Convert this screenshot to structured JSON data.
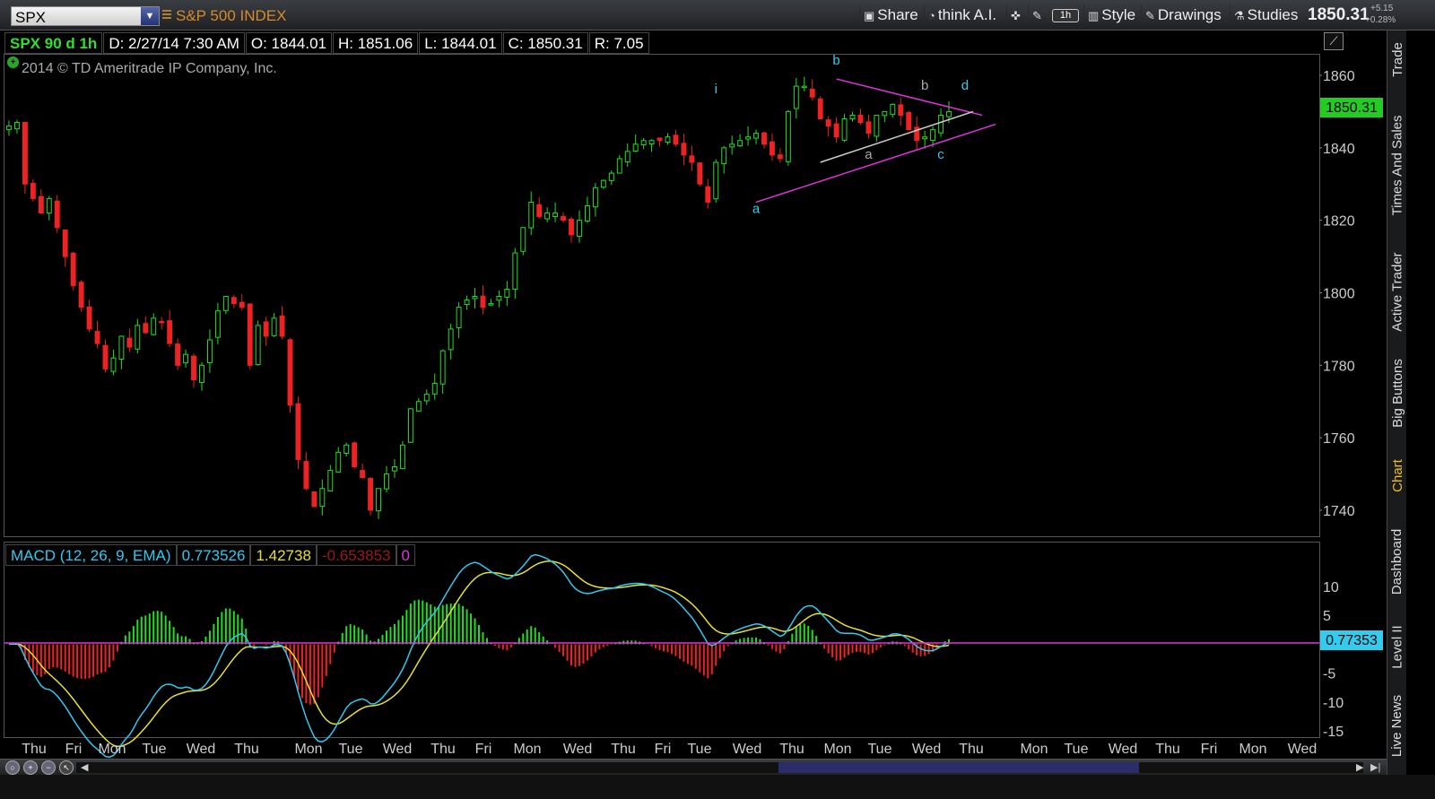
{
  "toolbar": {
    "symbol": "SPX",
    "symbol_name": "S&P 500 INDEX",
    "share": "Share",
    "think_ai": "think A.I.",
    "timeframe": "1h",
    "style": "Style",
    "drawings": "Drawings",
    "studies": "Studies",
    "last_price": "1850.31",
    "change_abs": "+5.15",
    "change_pct": "+0.28%"
  },
  "info": {
    "symbol_period": "SPX 90 d 1h",
    "date": "D: 2/27/14 7:30 AM",
    "open": "O: 1844.01",
    "high": "H: 1851.06",
    "low": "L: 1844.01",
    "close": "C: 1850.31",
    "range": "R: 7.05",
    "copyright": "2014 © TD Ameritrade IP Company, Inc."
  },
  "macd": {
    "label": "MACD (12, 26, 9, EMA)",
    "value": "0.773526",
    "avg": "1.42738",
    "diff": "-0.653853",
    "zero": "0",
    "last_badge": "0.77353"
  },
  "sidebar": {
    "items": [
      "Trade",
      "Times And Sales",
      "Active Trader",
      "Big Buttons",
      "Chart",
      "Dashboard",
      "Level II",
      "Live News"
    ]
  },
  "colors": {
    "up": "#22dd22",
    "down": "#ee2222",
    "macd": "#33c8f0",
    "signal": "#e8e030",
    "trendline": "#dd33dd",
    "triangle_base": "#cccccc",
    "price_badge": "#22cc22",
    "macd_badge": "#33ccee"
  },
  "chart_data": [
    {
      "type": "candlestick",
      "title": "SPX 90 d 1h",
      "y_ticks": [
        1860,
        1840,
        1820,
        1800,
        1780,
        1760,
        1740
      ],
      "ylim": [
        1733,
        1866
      ],
      "x_day_labels": [
        "Thu",
        "Fri",
        "Mon",
        "Tue",
        "Wed",
        "Thu",
        "Mon",
        "Tue",
        "Wed",
        "Thu",
        "Fri",
        "Mon",
        "Wed",
        "Thu",
        "Fri",
        "Tue",
        "Wed",
        "Thu",
        "Mon",
        "Tue",
        "Wed",
        "Thu",
        "Mon",
        "Tue",
        "Wed",
        "Thu",
        "Fri",
        "Mon",
        "Wed"
      ],
      "close_path": [
        1846,
        1847,
        1830,
        1826,
        1822,
        1826,
        1818,
        1810,
        1802,
        1796,
        1790,
        1786,
        1779,
        1782,
        1788,
        1785,
        1791,
        1789,
        1793,
        1792,
        1786,
        1780,
        1783,
        1776,
        1780,
        1787,
        1795,
        1799,
        1797,
        1796,
        1780,
        1791,
        1788,
        1793,
        1788,
        1769,
        1754,
        1746,
        1741,
        1746,
        1751,
        1756,
        1758,
        1752,
        1749,
        1740,
        1746,
        1750,
        1752,
        1758,
        1768,
        1770,
        1772,
        1775,
        1784,
        1790,
        1796,
        1798,
        1799,
        1796,
        1797,
        1799,
        1801,
        1811,
        1818,
        1825,
        1821,
        1822,
        1822,
        1820,
        1816,
        1820,
        1824,
        1829,
        1831,
        1833,
        1837,
        1839,
        1841,
        1842,
        1842,
        1842,
        1843,
        1841,
        1838,
        1836,
        1830,
        1825,
        1836,
        1840,
        1841,
        1842,
        1843,
        1844,
        1841,
        1838,
        1837,
        1850,
        1857,
        1857,
        1854,
        1848,
        1846,
        1843,
        1848,
        1849,
        1847,
        1844,
        1849,
        1850,
        1852,
        1849,
        1845,
        1842,
        1843,
        1845,
        1849,
        1850
      ],
      "annotations": [
        {
          "text": "i",
          "x_index": 88,
          "y": 1855
        },
        {
          "text": "a",
          "x_index": 93,
          "y": 1822
        },
        {
          "text": "b",
          "x_index": 103,
          "y": 1863
        },
        {
          "text": "a",
          "x_index": 107,
          "y": 1837
        },
        {
          "text": "b",
          "x_index": 114,
          "y": 1856
        },
        {
          "text": "c",
          "x_index": 116,
          "y": 1837
        },
        {
          "text": "d",
          "x_index": 119,
          "y": 1856
        }
      ]
    },
    {
      "type": "macd",
      "y_ticks": [
        10,
        5,
        -5,
        -10,
        -15
      ],
      "ylim": [
        -16.5,
        14
      ]
    }
  ]
}
